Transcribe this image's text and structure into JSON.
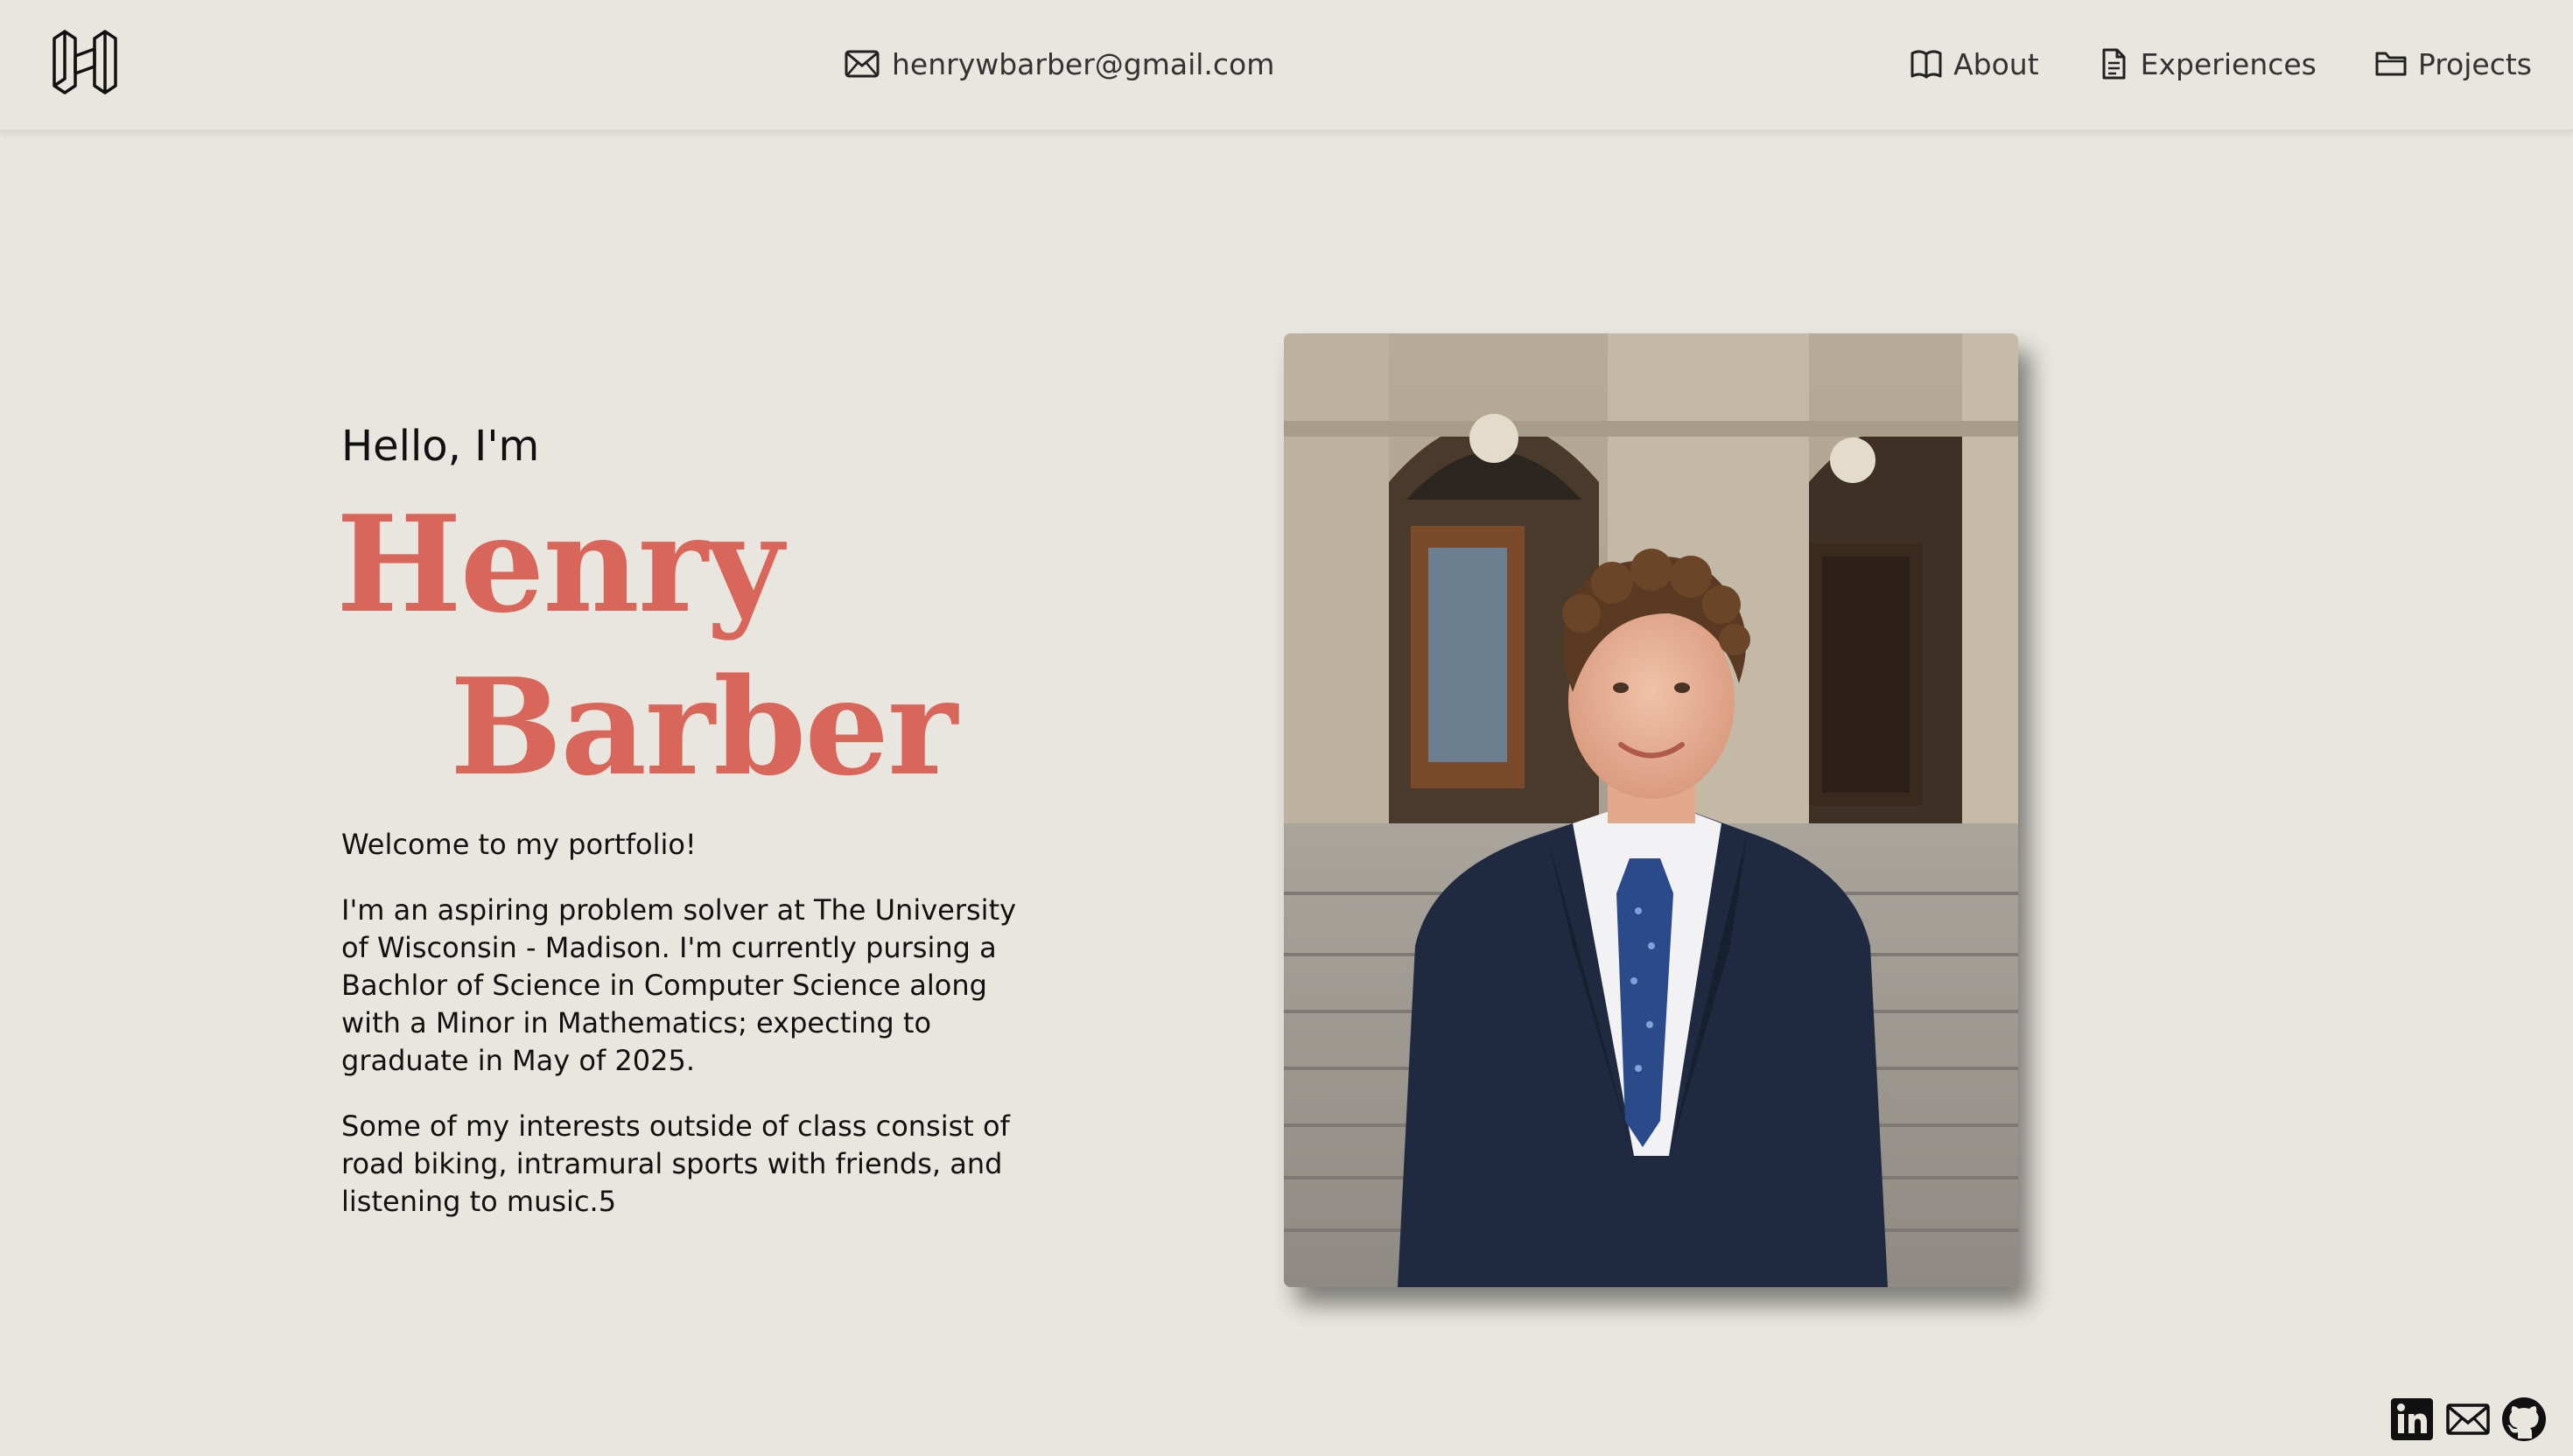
{
  "header": {
    "logo_icon": "h-monogram-logo",
    "email": "henrywbarber@gmail.com",
    "nav": [
      {
        "label": "About",
        "icon": "book-icon"
      },
      {
        "label": "Experiences",
        "icon": "document-icon"
      },
      {
        "label": "Projects",
        "icon": "folder-icon"
      }
    ]
  },
  "hero": {
    "greeting": "Hello, I'm",
    "first_name": "Henry",
    "last_name": "Barber",
    "accent_color": "#d9665a",
    "paragraphs": [
      "Welcome to my portfolio!",
      "I'm an aspiring problem solver at The University of Wisconsin - Madison. I'm currently pursing a Bachlor of Science in Computer Science along with a Minor in Mathematics; expecting to graduate in May of 2025.",
      "Some of my interests outside of class consist of road biking, intramural sports with friends, and listening to music.5"
    ]
  },
  "social": [
    {
      "icon": "linkedin-icon"
    },
    {
      "icon": "mail-icon"
    },
    {
      "icon": "github-icon"
    }
  ]
}
